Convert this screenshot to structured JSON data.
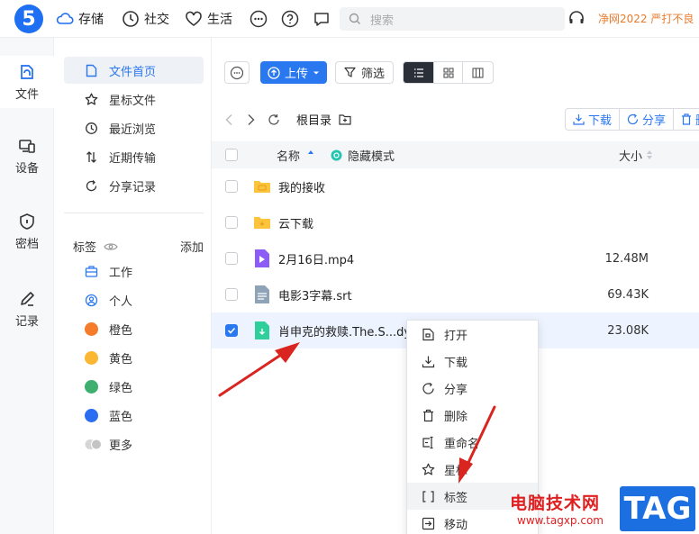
{
  "app": {
    "logo": "5"
  },
  "topnav": [
    {
      "label": "存储",
      "icon": "cloud-icon"
    },
    {
      "label": "社交",
      "icon": "clock-icon"
    },
    {
      "label": "生活",
      "icon": "heart-icon"
    }
  ],
  "search": {
    "placeholder": "搜索"
  },
  "promo": "净网2022 严打不良",
  "rail": [
    {
      "label": "文件",
      "icon": "file-icon"
    },
    {
      "label": "设备",
      "icon": "device-icon"
    },
    {
      "label": "密档",
      "icon": "shield-icon"
    },
    {
      "label": "记录",
      "icon": "pen-icon"
    }
  ],
  "sidebar": {
    "nav": [
      {
        "label": "文件首页",
        "icon": "file-home-icon"
      },
      {
        "label": "星标文件",
        "icon": "star-icon"
      },
      {
        "label": "最近浏览",
        "icon": "history-icon"
      },
      {
        "label": "近期传输",
        "icon": "transfer-icon"
      },
      {
        "label": "分享记录",
        "icon": "share-icon"
      }
    ],
    "tags_title": "标签",
    "tags_add": "添加",
    "tags": [
      {
        "label": "工作",
        "icon": "briefcase-icon"
      },
      {
        "label": "个人",
        "icon": "person-icon"
      },
      {
        "label": "橙色",
        "color": "#f57c2b"
      },
      {
        "label": "黄色",
        "color": "#fbb734"
      },
      {
        "label": "绿色",
        "color": "#3eaf6f"
      },
      {
        "label": "蓝色",
        "color": "#2a6df0"
      },
      {
        "label": "更多",
        "color": "#cccccc"
      }
    ]
  },
  "toolbar": {
    "upload": "上传",
    "filter": "筛选"
  },
  "path": {
    "root": "根目录",
    "actions": [
      "下载",
      "分享",
      "删"
    ]
  },
  "table": {
    "col_name": "名称",
    "hidden_mode": "隐藏模式",
    "col_size": "大小",
    "rows": [
      {
        "name": "我的接收",
        "size": "",
        "type": "folder",
        "checked": false
      },
      {
        "name": "云下载",
        "size": "",
        "type": "folder",
        "checked": false
      },
      {
        "name": "2月16日.mp4",
        "size": "12.48M",
        "type": "video",
        "checked": false
      },
      {
        "name": "电影3字幕.srt",
        "size": "69.43K",
        "type": "text",
        "checked": false
      },
      {
        "name": "肖申克的救赎.The.S...dy",
        "size": "23.08K",
        "type": "doc",
        "checked": true
      }
    ]
  },
  "context_menu": [
    {
      "label": "打开",
      "icon": "open-icon"
    },
    {
      "label": "下载",
      "icon": "download-icon"
    },
    {
      "label": "分享",
      "icon": "share-icon"
    },
    {
      "label": "删除",
      "icon": "trash-icon"
    },
    {
      "label": "重命名",
      "icon": "rename-icon"
    },
    {
      "label": "星标",
      "icon": "star-icon"
    },
    {
      "label": "标签",
      "icon": "tag-bracket-icon"
    },
    {
      "label": "移动",
      "icon": "move-icon"
    }
  ],
  "watermark": {
    "text": "电脑技术网",
    "url": "www.tagxp.com",
    "badge": "TAG"
  },
  "colors": {
    "accent": "#2a78f0",
    "logo": "#1e6ff1",
    "promo": "#e87a2b",
    "arrow": "#d9241f"
  }
}
